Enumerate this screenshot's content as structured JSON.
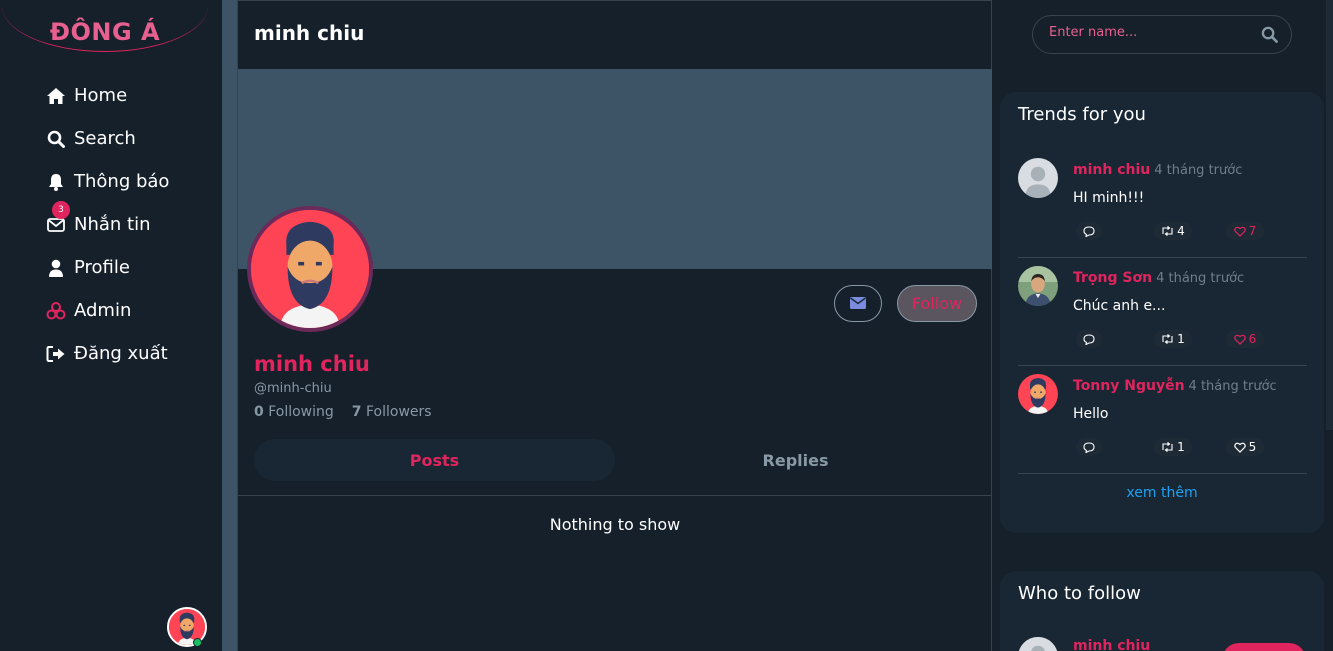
{
  "brand": {
    "logo": "ĐÔNG Á"
  },
  "nav": {
    "items": [
      {
        "label": "Home",
        "icon": "home-icon"
      },
      {
        "label": "Search",
        "icon": "search-icon"
      },
      {
        "label": "Thông báo",
        "icon": "bell-icon"
      },
      {
        "label": "Nhắn tin",
        "icon": "mail-icon",
        "badge": "3"
      },
      {
        "label": "Profile",
        "icon": "user-icon"
      },
      {
        "label": "Admin",
        "icon": "biohazard-icon"
      },
      {
        "label": "Đăng xuất",
        "icon": "logout-icon"
      }
    ]
  },
  "main": {
    "header_title": "minh chiu",
    "follow_label": "Follow",
    "profile": {
      "name": "minh chiu",
      "handle": "@minh-chiu",
      "following_count": "0",
      "following_label": "Following",
      "followers_count": "7",
      "followers_label": "Followers"
    },
    "tabs": [
      {
        "label": "Posts",
        "active": true
      },
      {
        "label": "Replies",
        "active": false
      }
    ],
    "empty_message": "Nothing to show"
  },
  "search": {
    "placeholder": "Enter name..."
  },
  "trends": {
    "title": "Trends for you",
    "items": [
      {
        "name": "minh chiu",
        "time": "4 tháng trước",
        "text": "HI minh!!!",
        "retweets": "4",
        "likes": "7",
        "liked": true
      },
      {
        "name": "Trọng Sơn",
        "time": "4 tháng trước",
        "text": "Chúc anh e...",
        "retweets": "1",
        "likes": "6",
        "liked": true
      },
      {
        "name": "Tonny Nguyễn",
        "time": "4 tháng trước",
        "text": "Hello",
        "retweets": "1",
        "likes": "5",
        "liked": false
      }
    ],
    "see_more": "xem thêm"
  },
  "who_to_follow": {
    "title": "Who to follow",
    "items": [
      {
        "name": "minh chiu"
      }
    ]
  },
  "colors": {
    "accent": "#e0245e",
    "bg": "#15202b",
    "card": "#192734",
    "link": "#1da1f2"
  }
}
